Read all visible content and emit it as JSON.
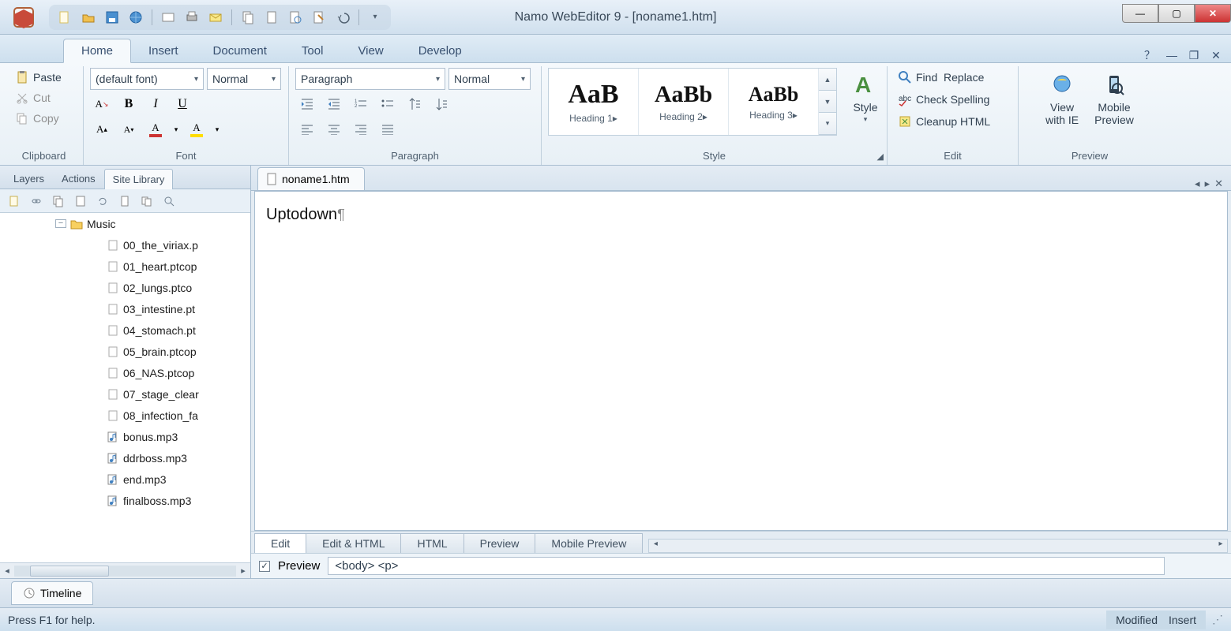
{
  "window": {
    "title": "Namo WebEditor 9 - [noname1.htm]"
  },
  "ribbon_tabs": [
    "Home",
    "Insert",
    "Document",
    "Tool",
    "View",
    "Develop"
  ],
  "ribbon_active_tab": "Home",
  "clipboard": {
    "paste": "Paste",
    "cut": "Cut",
    "copy": "Copy",
    "group_label": "Clipboard"
  },
  "font": {
    "family": "(default font)",
    "size_label": "Normal",
    "group_label": "Font"
  },
  "paragraph": {
    "style_combo": "Paragraph",
    "size_combo": "Normal",
    "group_label": "Paragraph"
  },
  "style_gallery": {
    "items": [
      {
        "sample": "AaB",
        "name": "Heading 1"
      },
      {
        "sample": "AaBb",
        "name": "Heading 2"
      },
      {
        "sample": "AaBb",
        "name": "Heading 3"
      }
    ],
    "style_btn": "Style",
    "group_label": "Style"
  },
  "edit_group": {
    "find": "Find",
    "replace": "Replace",
    "spell": "Check Spelling",
    "cleanup": "Cleanup HTML",
    "group_label": "Edit"
  },
  "preview_group": {
    "ie": "View\nwith IE",
    "mobile": "Mobile\nPreview",
    "group_label": "Preview"
  },
  "left_panel": {
    "tabs": [
      "Layers",
      "Actions",
      "Site Library"
    ],
    "active_tab": "Site Library",
    "folder": "Music",
    "files": [
      "00_the_viriax.p",
      "01_heart.ptcop",
      "02_lungs.ptco",
      "03_intestine.pt",
      "04_stomach.pt",
      "05_brain.ptcop",
      "06_NAS.ptcop",
      "07_stage_clear",
      "08_infection_fa",
      "bonus.mp3",
      "ddrboss.mp3",
      "end.mp3",
      "finalboss.mp3"
    ]
  },
  "document": {
    "tab_name": "noname1.htm",
    "content": "Uptodown",
    "modes": [
      "Edit",
      "Edit & HTML",
      "HTML",
      "Preview",
      "Mobile Preview"
    ],
    "active_mode": "Edit",
    "preview_checkbox": "Preview",
    "breadcrumb": "<body> <p>"
  },
  "timeline": {
    "label": "Timeline"
  },
  "status": {
    "help": "Press F1 for help.",
    "modified": "Modified",
    "insert": "Insert"
  }
}
